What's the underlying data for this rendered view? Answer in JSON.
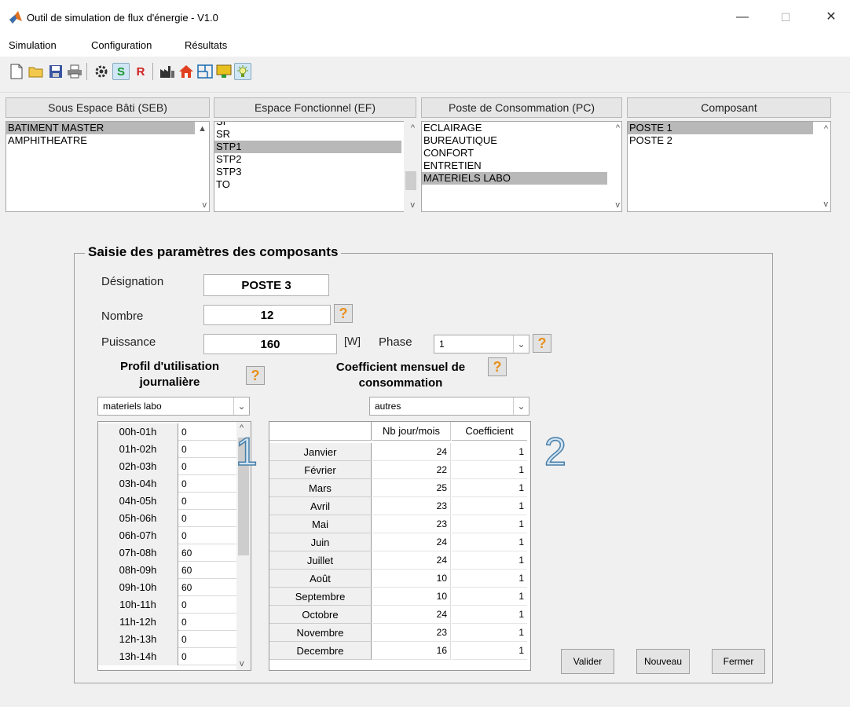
{
  "window": {
    "title": "Outil de simulation de flux d'énergie - V1.0",
    "minimize": "—",
    "maximize": "☐",
    "close": "✕"
  },
  "menu": [
    "Simulation",
    "Configuration",
    "Résultats"
  ],
  "toolbar": {
    "s_label": "S",
    "r_label": "R"
  },
  "columns": {
    "seb_header": "Sous Espace Bâti (SEB)",
    "ef_header": "Espace Fonctionnel (EF)",
    "pc_header": "Poste de  Consommation (PC)",
    "comp_header": "Composant",
    "seb_items": [
      "BATIMENT MASTER",
      "AMPHITHEATRE"
    ],
    "seb_selected": 0,
    "ef_items": [
      "SI",
      "SR",
      "STP1",
      "STP2",
      "STP3",
      "TO"
    ],
    "ef_selected": 2,
    "pc_items": [
      "ECLAIRAGE",
      "BUREAUTIQUE",
      "CONFORT",
      "ENTRETIEN",
      "MATERIELS LABO"
    ],
    "pc_selected": 4,
    "comp_items": [
      "POSTE 1",
      "POSTE 2"
    ],
    "comp_selected": 0
  },
  "panel": {
    "title": "Saisie des paramètres des composants",
    "designation_label": "Désignation",
    "designation_value": "POSTE 3",
    "nombre_label": "Nombre",
    "nombre_value": "12",
    "puissance_label": "Puissance",
    "puissance_value": "160",
    "unit": "[W]",
    "phase_label": "Phase",
    "phase_value": "1",
    "help": "?",
    "profil_label_1": "Profil d'utilisation",
    "profil_label_2": "journalière",
    "profil_value": "materiels labo",
    "coef_label_1": "Coefficient mensuel de",
    "coef_label_2": "consommation",
    "coef_value": "autres",
    "marker_1": "1",
    "marker_2": "2",
    "hours": [
      {
        "h": "00h-01h",
        "v": "0"
      },
      {
        "h": "01h-02h",
        "v": "0"
      },
      {
        "h": "02h-03h",
        "v": "0"
      },
      {
        "h": "03h-04h",
        "v": "0"
      },
      {
        "h": "04h-05h",
        "v": "0"
      },
      {
        "h": "05h-06h",
        "v": "0"
      },
      {
        "h": "06h-07h",
        "v": "0"
      },
      {
        "h": "07h-08h",
        "v": "60"
      },
      {
        "h": "08h-09h",
        "v": "60"
      },
      {
        "h": "09h-10h",
        "v": "60"
      },
      {
        "h": "10h-11h",
        "v": "0"
      },
      {
        "h": "11h-12h",
        "v": "0"
      },
      {
        "h": "12h-13h",
        "v": "0"
      },
      {
        "h": "13h-14h",
        "v": "0"
      }
    ],
    "month_headers": {
      "days": "Nb jour/mois",
      "coef": "Coefficient"
    },
    "months": [
      {
        "m": "Janvier",
        "d": "24",
        "c": "1"
      },
      {
        "m": "Février",
        "d": "22",
        "c": "1"
      },
      {
        "m": "Mars",
        "d": "25",
        "c": "1"
      },
      {
        "m": "Avril",
        "d": "23",
        "c": "1"
      },
      {
        "m": "Mai",
        "d": "23",
        "c": "1"
      },
      {
        "m": "Juin",
        "d": "24",
        "c": "1"
      },
      {
        "m": "Juillet",
        "d": "24",
        "c": "1"
      },
      {
        "m": "Août",
        "d": "10",
        "c": "1"
      },
      {
        "m": "Septembre",
        "d": "10",
        "c": "1"
      },
      {
        "m": "Octobre",
        "d": "24",
        "c": "1"
      },
      {
        "m": "Novembre",
        "d": "23",
        "c": "1"
      },
      {
        "m": "Decembre",
        "d": "16",
        "c": "1"
      }
    ],
    "btn_valider": "Valider",
    "btn_nouveau": "Nouveau",
    "btn_fermer": "Fermer"
  }
}
